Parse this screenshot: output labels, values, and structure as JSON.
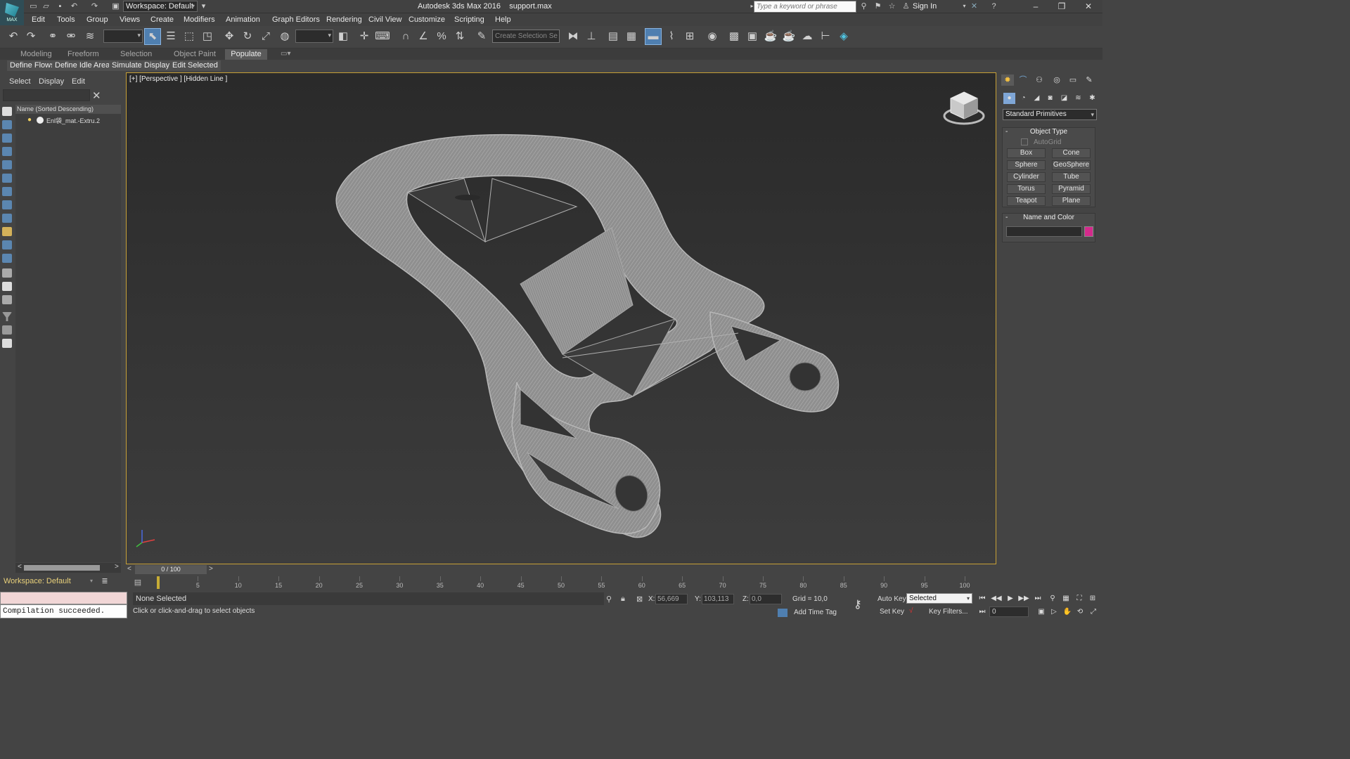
{
  "app": {
    "logo_label": "MAX",
    "title": "Autodesk 3ds Max 2016    support.max",
    "workspace": "Workspace: Default",
    "search_placeholder": "Type a keyword or phrase",
    "sign_in": "Sign In"
  },
  "menu": [
    "Edit",
    "Tools",
    "Group",
    "Views",
    "Create",
    "Modifiers",
    "Animation",
    "Graph Editors",
    "Rendering",
    "Civil View",
    "Customize",
    "Scripting",
    "Help"
  ],
  "toolbar": {
    "selection_set_placeholder": "Create Selection Se"
  },
  "ribbon": {
    "tabs": [
      "Modeling",
      "Freeform",
      "Selection",
      "Object Paint"
    ],
    "active_tab": "Populate",
    "buttons": [
      "Define Flows",
      "Define Idle Areas",
      "Simulate",
      "Display",
      "Edit Selected"
    ]
  },
  "scene_explorer": {
    "tabs": [
      "Select",
      "Display",
      "Edit"
    ],
    "column_header": "Name (Sorted Descending)",
    "items": [
      {
        "name": "Enl袋_mat.-Extru.2"
      }
    ]
  },
  "viewport": {
    "label": "[+] [Perspective ] [Hidden Line ]",
    "mesh_color": "#a3a3a3",
    "border_color": "#c7a036"
  },
  "command_panel": {
    "category_dropdown": "Standard Primitives",
    "object_type": {
      "title": "Object Type",
      "autogrid": "AutoGrid",
      "buttons": [
        "Box",
        "Cone",
        "Sphere",
        "GeoSphere",
        "Cylinder",
        "Tube",
        "Torus",
        "Pyramid",
        "Teapot",
        "Plane"
      ]
    },
    "name_and_color": {
      "title": "Name and Color",
      "swatch_color": "#d42a8c"
    },
    "rollout_collapse": "-"
  },
  "timeline": {
    "slider_text": "0 / 100",
    "ticks": [
      "5",
      "10",
      "15",
      "20",
      "25",
      "30",
      "35",
      "40",
      "45",
      "50",
      "55",
      "60",
      "65",
      "70",
      "75",
      "80",
      "85",
      "90",
      "95",
      "100"
    ],
    "prev": "<",
    "next": ">"
  },
  "status": {
    "workspace": "Workspace: Default",
    "listener_output": "Compilation succeeded.",
    "selection": "None Selected",
    "prompt": "Click or click-and-drag to select objects",
    "x_label": "X:",
    "x_value": "56,669",
    "y_label": "Y:",
    "y_value": "103,113",
    "z_label": "Z:",
    "z_value": "0,0",
    "grid": "Grid = 10,0",
    "add_time_tag": "Add Time Tag",
    "auto_key": "Auto Key",
    "set_key": "Set Key",
    "key_filters": "Key Filters...",
    "key_mode": "Selected",
    "frame": "0"
  }
}
